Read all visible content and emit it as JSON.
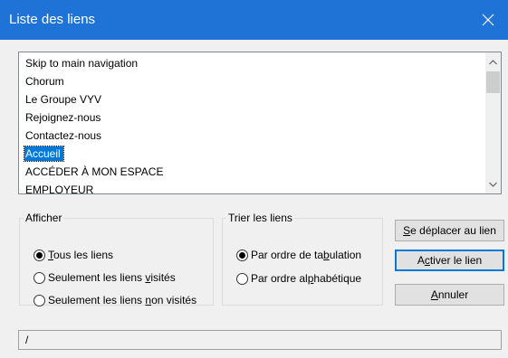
{
  "window": {
    "title": "Liste des liens"
  },
  "links": [
    "Skip to main navigation",
    "Chorum",
    "Le Groupe VYV",
    "Rejoignez-nous",
    "Contactez-nous",
    "Accueil",
    "ACCÉDER À MON ESPACE",
    "EMPLOYEUR"
  ],
  "selected_link": "Accueil",
  "afficher": {
    "legend": "Afficher",
    "options": [
      {
        "before": "",
        "key": "T",
        "after": "ous les liens",
        "checked": true
      },
      {
        "before": "Seulement les liens ",
        "key": "v",
        "after": "isités",
        "checked": false
      },
      {
        "before": "Seulement les liens ",
        "key": "n",
        "after": "on visités",
        "checked": false
      }
    ]
  },
  "trier": {
    "legend": "Trier les liens",
    "options": [
      {
        "before": "Par ordre de ta",
        "key": "b",
        "after": "ulation",
        "checked": true
      },
      {
        "before": "Par ordre al",
        "key": "p",
        "after": "habétique",
        "checked": false
      }
    ]
  },
  "buttons": {
    "move": {
      "key": "S",
      "rest": "e déplacer au lien"
    },
    "activate": {
      "before": "A",
      "key": "c",
      "after": "tiver le lien"
    },
    "cancel": {
      "key": "A",
      "rest": "nnuler"
    }
  },
  "status_text": "/",
  "icons": {
    "close": "close-icon",
    "scroll_up": "chevron-up-icon",
    "scroll_down": "chevron-down-icon"
  }
}
